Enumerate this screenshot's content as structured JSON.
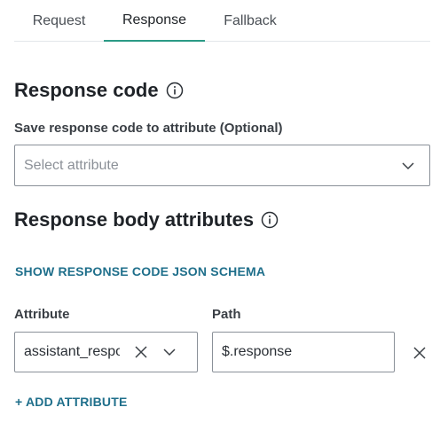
{
  "tabs": [
    {
      "label": "Request"
    },
    {
      "label": "Response"
    },
    {
      "label": "Fallback"
    }
  ],
  "active_tab": "Response",
  "response_code": {
    "title": "Response code",
    "save_label": "Save response code to attribute (Optional)",
    "select_placeholder": "Select attribute"
  },
  "response_body": {
    "title": "Response body attributes",
    "schema_link": "SHOW RESPONSE CODE JSON SCHEMA",
    "attribute_label": "Attribute",
    "path_label": "Path",
    "rows": [
      {
        "attribute": "assistant_response",
        "path": "$.response"
      }
    ],
    "add_link": "+ ADD ATTRIBUTE"
  },
  "colors": {
    "accent_tab": "#2b9a86",
    "link": "#1f6f8b"
  }
}
